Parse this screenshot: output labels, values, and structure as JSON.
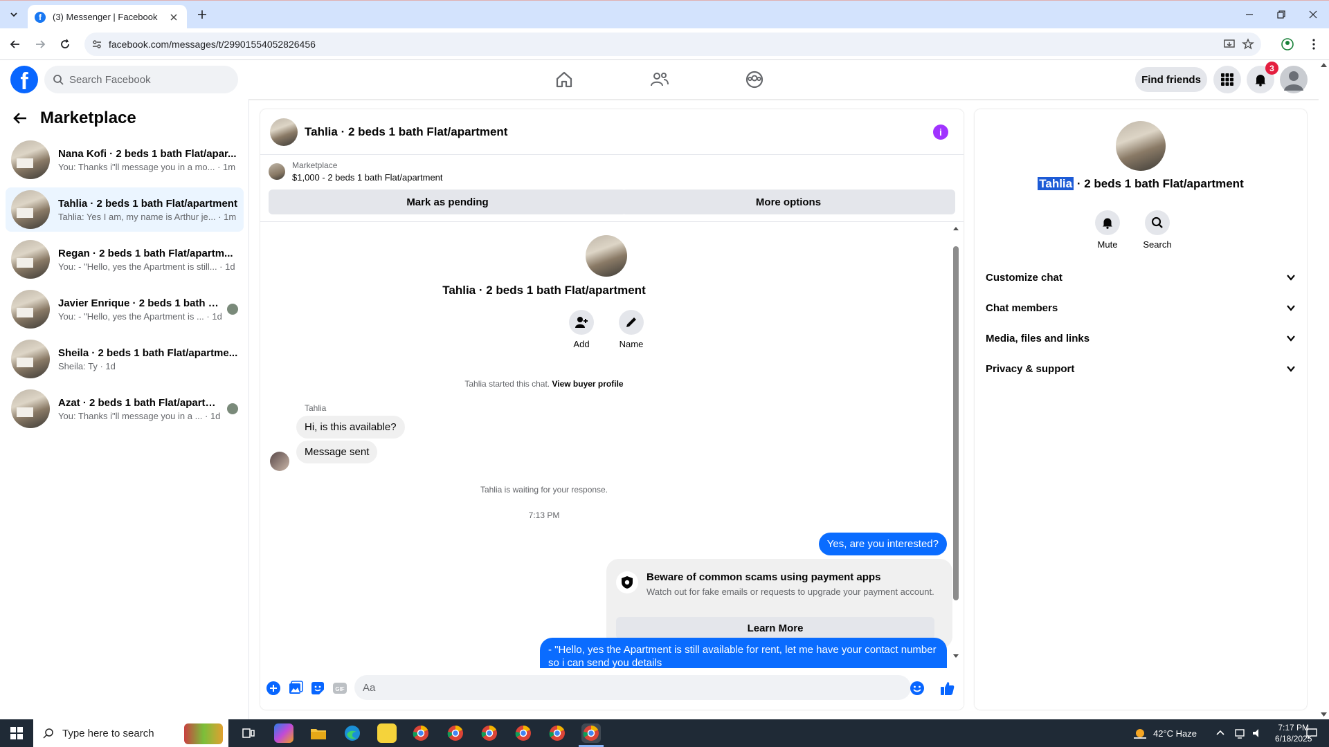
{
  "browser": {
    "tab_title": "(3) Messenger | Facebook",
    "url": "facebook.com/messages/t/29901554052826456"
  },
  "fb": {
    "search_placeholder": "Search Facebook",
    "find_friends": "Find friends",
    "notification_count": "3"
  },
  "sidebar": {
    "title": "Marketplace",
    "conversations": [
      {
        "name": "Nana Kofi · 2 beds 1 bath Flat/apar...",
        "preview": "You: Thanks i\"ll message you in a mo... · 1m",
        "active": false
      },
      {
        "name": "Tahlia · 2 beds 1 bath Flat/apartment",
        "preview": "Tahlia: Yes I am, my name is Arthur je... · 1m",
        "active": true
      },
      {
        "name": "Regan · 2 beds 1 bath Flat/apartm...",
        "preview": "You: - \"Hello, yes the Apartment is still... · 1d",
        "active": false
      },
      {
        "name": "Javier Enrique · 2 beds 1 bath Fl...",
        "preview": "You: - \"Hello, yes the Apartment is ... · 1d",
        "active": false
      },
      {
        "name": "Sheila · 2 beds 1 bath Flat/apartme...",
        "preview": "Sheila: Ty · 1d",
        "active": false
      },
      {
        "name": "Azat · 2 beds 1 bath Flat/apartm...",
        "preview": "You: Thanks i\"ll message you in a ... · 1d",
        "active": false
      }
    ]
  },
  "chat": {
    "header_title": "Tahlia · 2 beds 1 bath Flat/apartment",
    "listing_source": "Marketplace",
    "listing_title": "$1,000 - 2 beds 1 bath Flat/apartment",
    "mark_pending": "Mark as pending",
    "more_options": "More options",
    "intro_name": "Tahlia · 2 beds 1 bath Flat/apartment",
    "intro_add": "Add",
    "intro_name_label": "Name",
    "started_text": "Tahlia started this chat.",
    "view_profile": "View buyer profile",
    "sender": "Tahlia",
    "msg1": "Hi, is this available?",
    "msg2": "Message sent",
    "waiting": "Tahlia is waiting for your response.",
    "time": "7:13 PM",
    "out1": "Yes, are you interested?",
    "scam_title": "Beware of common scams using payment apps",
    "scam_desc": "Watch out for fake emails or requests to upgrade your payment account.",
    "learn_more": "Learn More",
    "out2": "-      \"Hello, yes the   Apartment is still available for rent, let me have your contact number so i can send you details",
    "composer_placeholder": "Aa"
  },
  "details": {
    "name_highlight": "Tahlia",
    "name_rest": " · 2 beds 1 bath Flat/apartment",
    "mute": "Mute",
    "search": "Search",
    "rows": [
      "Customize chat",
      "Chat members",
      "Media, files and links",
      "Privacy & support"
    ]
  },
  "taskbar": {
    "search_placeholder": "Type here to search",
    "weather": "42°C  Haze",
    "time": "7:17 PM",
    "date": "6/18/2025"
  },
  "colors": {
    "fb_blue": "#0866ff",
    "message_blue": "#0a6cff",
    "info_purple": "#a033ff",
    "badge_red": "#e41e3f"
  }
}
